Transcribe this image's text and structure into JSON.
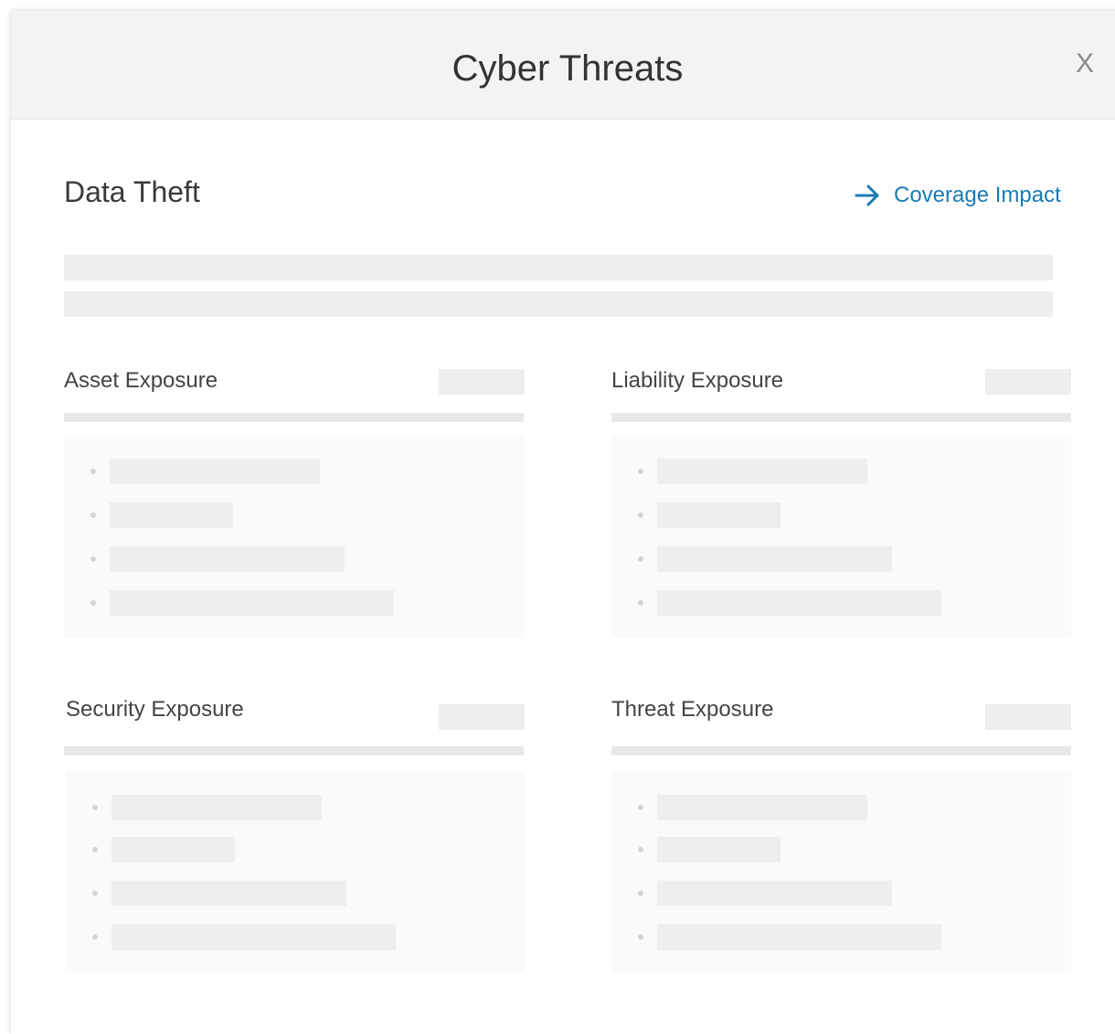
{
  "modal": {
    "title": "Cyber Threats",
    "close_label": "X"
  },
  "threat": {
    "title": "Data Theft",
    "coverage_link_label": "Coverage Impact",
    "link_icon": "arrow-right-icon",
    "accent_color": "#1a7bb3"
  },
  "cards": [
    {
      "title": "Asset Exposure"
    },
    {
      "title": "Liability Exposure"
    },
    {
      "title": "Security Exposure"
    },
    {
      "title": "Threat Exposure"
    }
  ]
}
